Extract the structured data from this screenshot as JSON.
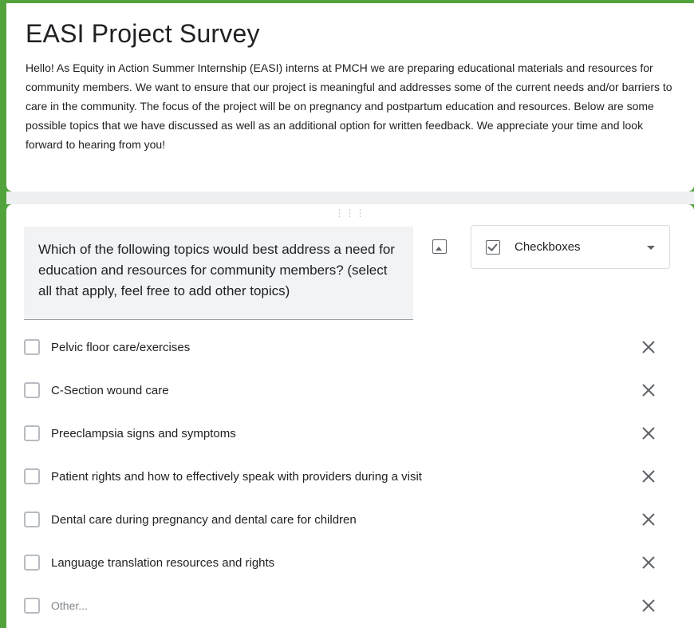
{
  "form": {
    "title": "EASI Project Survey",
    "description": "Hello! As Equity in Action Summer Internship (EASI) interns at PMCH we are preparing educational materials and resources for community members. We want to ensure that our project is meaningful and addresses some of the current needs and/or barriers to care in the community. The focus of the project will be on pregnancy and postpartum education and resources. Below are some possible topics that we have discussed as well as an additional option for written feedback. We appreciate your time and look forward to hearing from you!"
  },
  "question": {
    "text": "Which of the following topics would best address a need for education and resources for community members? (select all that apply, feel free to add other topics)",
    "type_label": "Checkboxes",
    "options": [
      {
        "label": "Pelvic floor care/exercises"
      },
      {
        "label": "C-Section wound care"
      },
      {
        "label": "Preeclampsia signs and symptoms"
      },
      {
        "label": "Patient rights and how to effectively speak with providers during a visit"
      },
      {
        "label": "Dental care during pregnancy and dental care for children"
      },
      {
        "label": "Language translation resources and rights"
      },
      {
        "label": "Other..."
      }
    ]
  },
  "icons": {
    "drag": "drag-handle-icon",
    "image": "image-icon",
    "type": "checkbox-icon",
    "dropdown": "chevron-down-icon",
    "remove": "close-icon"
  },
  "colors": {
    "frame": "#53a33d",
    "card": "#ffffff",
    "question_bg": "#f1f3f4",
    "text": "#202124"
  }
}
